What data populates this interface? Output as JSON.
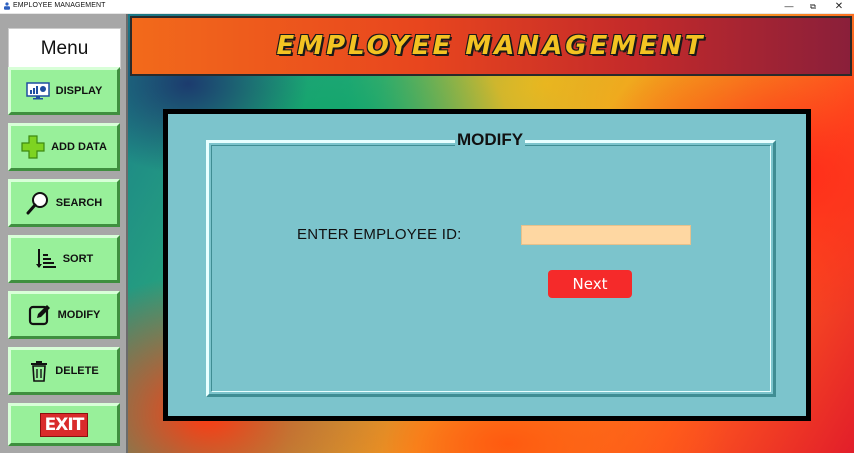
{
  "window": {
    "title": "EMPLOYEE MANAGEMENT",
    "controls": {
      "minimize": "—",
      "maximize": "⧉",
      "close": "✕"
    }
  },
  "sidebar": {
    "menu_title": "Menu",
    "items": [
      {
        "label": "DISPLAY",
        "icon": "display-icon"
      },
      {
        "label": "ADD DATA",
        "icon": "plus-icon"
      },
      {
        "label": "SEARCH",
        "icon": "magnifier-icon"
      },
      {
        "label": "SORT",
        "icon": "sort-icon"
      },
      {
        "label": "MODIFY",
        "icon": "edit-icon"
      },
      {
        "label": "DELETE",
        "icon": "trash-icon"
      }
    ],
    "exit_label": "EXIT"
  },
  "main": {
    "banner_title": "Employee Management",
    "panel": {
      "legend": "MODIFY",
      "field_label": "ENTER EMPLOYEE ID:",
      "employee_id_value": "",
      "next_label": "Next"
    }
  },
  "colors": {
    "sidebar_button": "#98f09a",
    "panel": "#7cc4cc",
    "input_bg": "#fed7a2",
    "next_button": "#f52a2a",
    "banner_text": "#f3c322"
  }
}
